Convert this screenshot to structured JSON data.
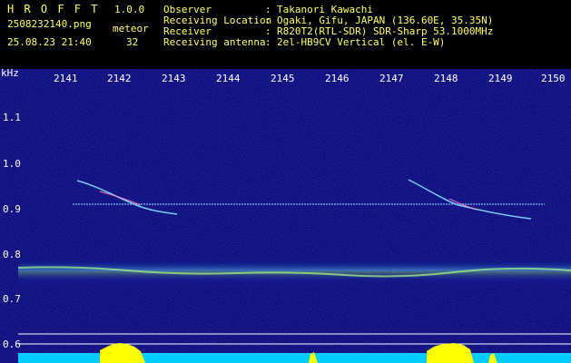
{
  "app": {
    "title": "H R O F F T",
    "version": "1.0.0",
    "filename": "2508232140.png",
    "datetime": "25.08.23 21:40",
    "meteor_label": "meteor",
    "meteor_count": "32"
  },
  "info": {
    "rows": [
      {
        "label": "Observer",
        "sep": ":",
        "value": "Takanori Kawachi"
      },
      {
        "label": "Receiving Location",
        "sep": ":",
        "value": "Ogaki, Gifu, JAPAN (136.60E, 35.35N)"
      },
      {
        "label": "Receiver",
        "sep": ":",
        "value": "R820T2(RTL-SDR) SDR-Sharp 53.1000MHz"
      },
      {
        "label": "Receiving antenna",
        "sep": ":",
        "value": "2el-HB9CV Vertical (el. E-W)"
      }
    ]
  },
  "axes": {
    "y_unit": "kHz",
    "y_ticks": [
      "1.1",
      "1.0",
      "0.9",
      "0.8",
      "0.7",
      "0.6"
    ],
    "x_ticks": [
      "2141",
      "2142",
      "2143",
      "2144",
      "2145",
      "2146",
      "2147",
      "2148",
      "2149",
      "2150"
    ]
  },
  "colors": {
    "background": "#000000",
    "spectrum_bg": "#0a0a6e",
    "header_yellow": "#ffff66",
    "signal_cyan": "#66ddff",
    "activity_yellow": "#ffff00",
    "activity_cyan": "#00ccff"
  }
}
